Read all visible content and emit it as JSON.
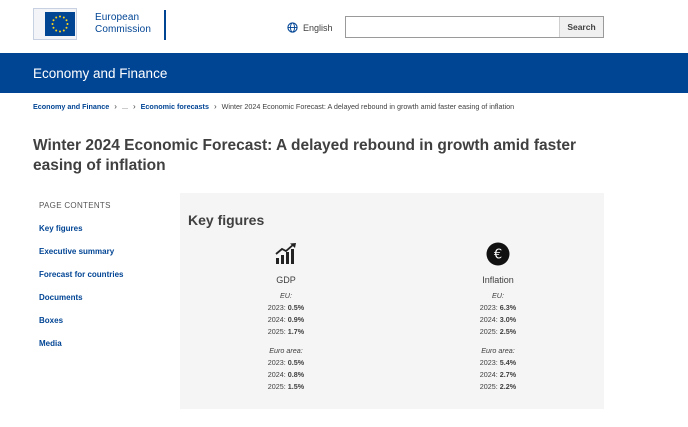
{
  "header": {
    "logo_line1": "European",
    "logo_line2": "Commission",
    "language": "English",
    "search_placeholder": "",
    "search_button": "Search"
  },
  "banner": {
    "title": "Economy and Finance"
  },
  "breadcrumb": {
    "home": "Economy and Finance",
    "ellipsis": "...",
    "section": "Economic forecasts",
    "current": "Winter 2024 Economic Forecast: A delayed rebound in growth amid faster easing of inflation"
  },
  "page_title": "Winter 2024 Economic Forecast: A delayed rebound in growth amid faster easing of inflation",
  "side_nav": {
    "caption": "PAGE CONTENTS",
    "items": [
      "Key figures",
      "Executive summary",
      "Forecast for countries",
      "Documents",
      "Boxes",
      "Media"
    ]
  },
  "key_figures": {
    "heading": "Key figures",
    "gdp": {
      "title": "GDP",
      "icon": "growth-chart-icon",
      "eu_label": "EU:",
      "eu": [
        {
          "year": "2023:",
          "value": "0.5%"
        },
        {
          "year": "2024:",
          "value": "0.9%"
        },
        {
          "year": "2025:",
          "value": "1.7%"
        }
      ],
      "ea_label": "Euro area:",
      "ea": [
        {
          "year": "2023:",
          "value": "0.5%"
        },
        {
          "year": "2024:",
          "value": "0.8%"
        },
        {
          "year": "2025:",
          "value": "1.5%"
        }
      ]
    },
    "inflation": {
      "title": "Inflation",
      "icon": "euro-coin-icon",
      "eu_label": "EU:",
      "eu": [
        {
          "year": "2023:",
          "value": "6.3%"
        },
        {
          "year": "2024:",
          "value": "3.0%"
        },
        {
          "year": "2025:",
          "value": "2.5%"
        }
      ],
      "ea_label": "Euro area:",
      "ea": [
        {
          "year": "2023:",
          "value": "5.4%"
        },
        {
          "year": "2024:",
          "value": "2.7%"
        },
        {
          "year": "2025:",
          "value": "2.2%"
        }
      ]
    }
  },
  "colors": {
    "brand_blue": "#004494",
    "text": "#404040",
    "panel_bg": "#f5f5f5"
  }
}
